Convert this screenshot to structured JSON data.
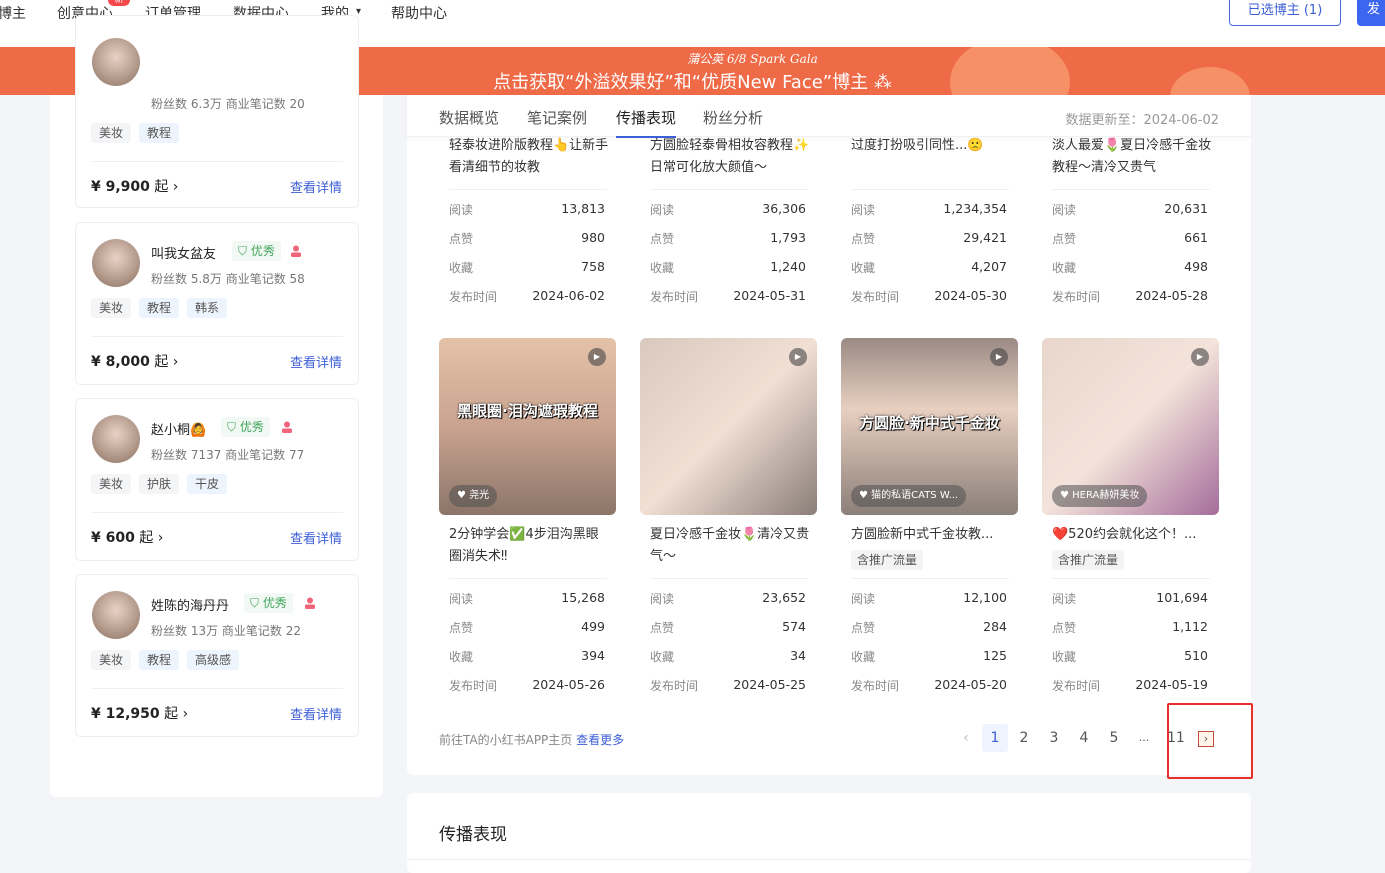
{
  "topnav": {
    "items": [
      "博主",
      "创意中心",
      "订单管理",
      "数据中心",
      "我的",
      "帮助中心"
    ],
    "new_badge": "新",
    "dropdown_icon": "▾",
    "selected_button": "已选博主 (1)",
    "primary_button": "发"
  },
  "banner": {
    "small": "蒲公英 6/8 Spark Gala",
    "main": "点击获取“外溢效果好”和“优质New Face”博主 ⁂"
  },
  "kols": [
    {
      "name": "",
      "good": "",
      "stats": "粉丝数 6.3万   商业笔记数 20",
      "tags": [
        "美妆",
        "教程"
      ],
      "price": "¥ 9,900",
      "price_suffix": "起 ›",
      "detail": "查看详情"
    },
    {
      "name": "叫我女盆友",
      "good": "优秀",
      "stats": "粉丝数 5.8万   商业笔记数 58",
      "tags": [
        "美妆",
        "教程",
        "韩系"
      ],
      "price": "¥ 8,000",
      "price_suffix": "起 ›",
      "detail": "查看详情"
    },
    {
      "name": "赵小桐🙆",
      "good": "优秀",
      "stats": "粉丝数 7137   商业笔记数 77",
      "tags": [
        "美妆",
        "护肤",
        "干皮"
      ],
      "price": "¥ 600",
      "price_suffix": "起 ›",
      "detail": "查看详情"
    },
    {
      "name": "姓陈的海丹丹",
      "good": "优秀",
      "stats": "粉丝数 13万   商业笔记数 22",
      "tags": [
        "美妆",
        "教程",
        "高级感"
      ],
      "price": "¥ 12,950",
      "price_suffix": "起 ›",
      "detail": "查看详情"
    }
  ],
  "tabs": [
    "数据概览",
    "笔记案例",
    "传播表现",
    "粉丝分析"
  ],
  "active_tab": "传播表现",
  "updated": "数据更新至：2024-06-02",
  "stat_labels": [
    "阅读",
    "点赞",
    "收藏",
    "发布时间"
  ],
  "notes_top": [
    {
      "title": "轻泰妆进阶版教程👆让新手看清细节的妆教",
      "values": [
        "13,813",
        "980",
        "758",
        "2024-06-02"
      ]
    },
    {
      "title": "方圆脸轻泰骨相妆容教程✨日常可化放大颜值～",
      "values": [
        "36,306",
        "1,793",
        "1,240",
        "2024-05-31"
      ]
    },
    {
      "title": "过度打扮吸引同性...🙁",
      "values": [
        "1,234,354",
        "29,421",
        "4,207",
        "2024-05-30"
      ]
    },
    {
      "title": "淡人最爱🌷夏日冷感千金妆教程～清冷又贵气",
      "values": [
        "20,631",
        "661",
        "498",
        "2024-05-28"
      ]
    }
  ],
  "notes_bottom": [
    {
      "title": "2分钟学会✅4步泪沟黑眼圈消失术‼",
      "promo": "",
      "img_text": "黑眼圈·泪沟遮瑕教程",
      "author": "尧光",
      "values": [
        "15,268",
        "499",
        "394",
        "2024-05-26"
      ]
    },
    {
      "title": "夏日冷感千金妆🌷清冷又贵气～",
      "promo": "",
      "img_text": "",
      "author": "",
      "values": [
        "23,652",
        "574",
        "34",
        "2024-05-25"
      ]
    },
    {
      "title": "方圆脸新中式千金妆教...",
      "promo": "含推广流量",
      "img_text": "方圆脸·新中式千金妆",
      "author": "猫的私语CATS W...",
      "values": [
        "12,100",
        "284",
        "125",
        "2024-05-20"
      ]
    },
    {
      "title": "❤️520约会就化这个！...",
      "promo": "含推广流量",
      "img_text": "",
      "author": "HERA赫妍美妆",
      "values": [
        "101,694",
        "1,112",
        "510",
        "2024-05-19"
      ]
    }
  ],
  "footer": {
    "text": "前往TA的小红书APP主页",
    "link": "查看更多"
  },
  "pagination": {
    "prev": "‹",
    "pages": [
      "1",
      "2",
      "3",
      "4",
      "5",
      "...",
      "11"
    ],
    "current": "1",
    "next": "›"
  },
  "section2_title": "传播表现"
}
